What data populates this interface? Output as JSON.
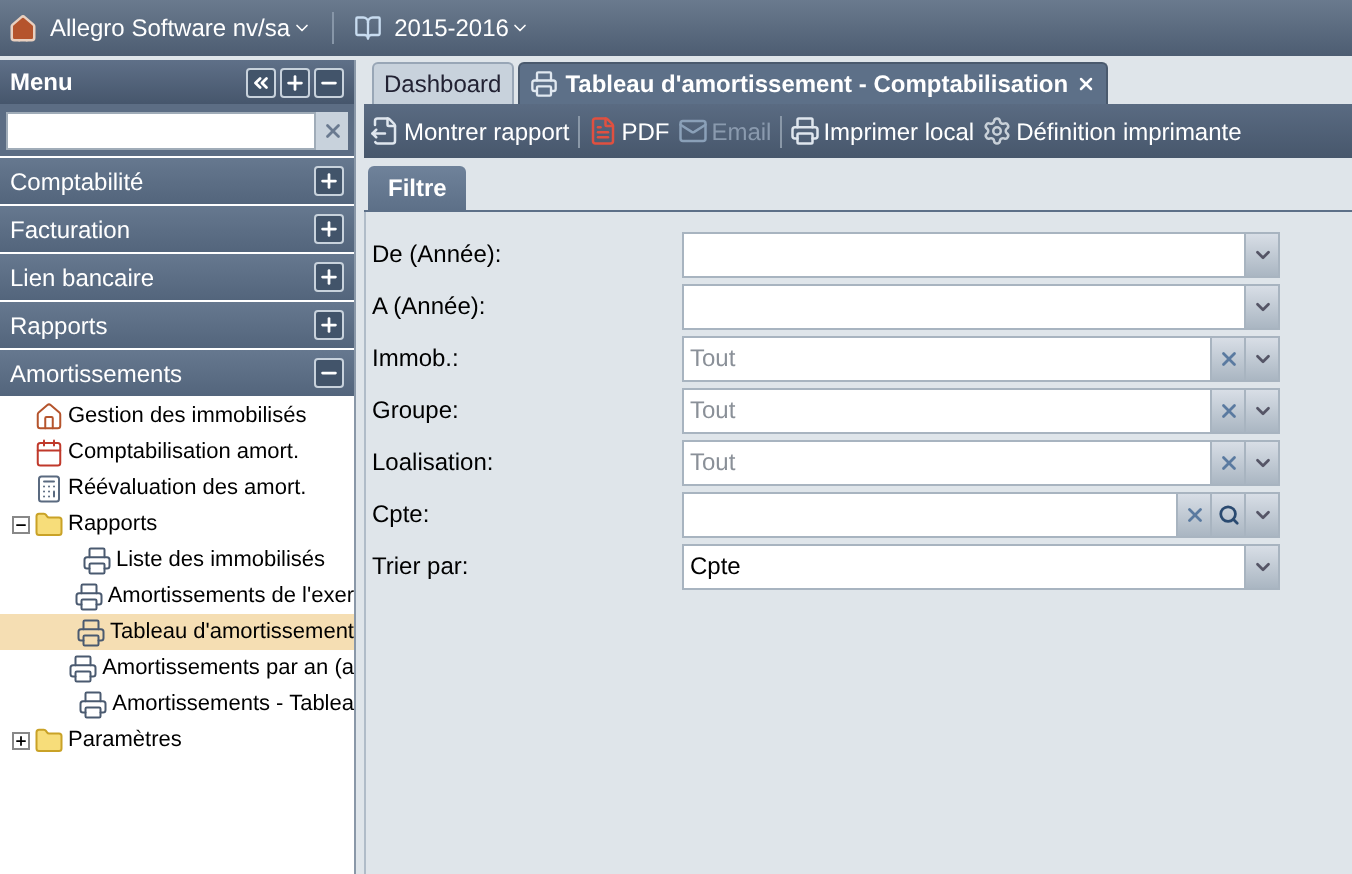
{
  "top_bar": {
    "company": "Allegro Software nv/sa",
    "year": "2015-2016"
  },
  "menu": {
    "title": "Menu",
    "sections": [
      {
        "label": "Comptabilité",
        "expanded": false
      },
      {
        "label": "Facturation",
        "expanded": false
      },
      {
        "label": "Lien bancaire",
        "expanded": false
      },
      {
        "label": "Rapports",
        "expanded": false
      },
      {
        "label": "Amortissements",
        "expanded": true
      }
    ],
    "tree": [
      {
        "label": "Gestion des immobilisés",
        "kind": "house",
        "selected": false
      },
      {
        "label": "Comptabilisation amort.",
        "kind": "calendar",
        "selected": false
      },
      {
        "label": "Réévaluation des amort.",
        "kind": "calculator",
        "selected": false
      },
      {
        "label": "Rapports",
        "kind": "folder",
        "expanded": true,
        "selected": false,
        "children": [
          {
            "label": "Liste des immobilisés",
            "kind": "printer",
            "selected": false
          },
          {
            "label": "Amortissements de l'exer",
            "kind": "printer",
            "selected": false
          },
          {
            "label": "Tableau d'amortissement",
            "kind": "printer",
            "selected": true
          },
          {
            "label": "Amortissements par an (a",
            "kind": "printer",
            "selected": false
          },
          {
            "label": "Amortissements - Tablea",
            "kind": "printer",
            "selected": false
          }
        ]
      },
      {
        "label": "Paramètres",
        "kind": "folder",
        "expanded": false,
        "selected": false
      }
    ]
  },
  "tabs": [
    {
      "label": "Dashboard",
      "selected": false,
      "closable": false
    },
    {
      "label": "Tableau d'amortissement - Comptabilisation",
      "selected": true,
      "closable": true
    }
  ],
  "toolbar": [
    {
      "label": "Montrer rapport",
      "kind": "report",
      "disabled": false
    },
    {
      "label": "PDF",
      "kind": "pdf",
      "disabled": false
    },
    {
      "label": "Email",
      "kind": "email",
      "disabled": true
    },
    {
      "label": "Imprimer local",
      "kind": "print",
      "disabled": false
    },
    {
      "label": "Définition imprimante",
      "kind": "settings",
      "disabled": false
    }
  ],
  "filter_tab": "Filtre",
  "fields": [
    {
      "label": "De (Année):",
      "kind": "combo"
    },
    {
      "label": "A (Année):",
      "kind": "combo"
    },
    {
      "label": "Immob.:",
      "kind": "clearable",
      "placeholder": "Tout"
    },
    {
      "label": "Groupe:",
      "kind": "clearable",
      "placeholder": "Tout"
    },
    {
      "label": "Loalisation:",
      "kind": "clearable",
      "placeholder": "Tout"
    },
    {
      "label": "Cpte:",
      "kind": "lookup"
    },
    {
      "label": "Trier par:",
      "kind": "combo",
      "value": "Cpte"
    }
  ]
}
